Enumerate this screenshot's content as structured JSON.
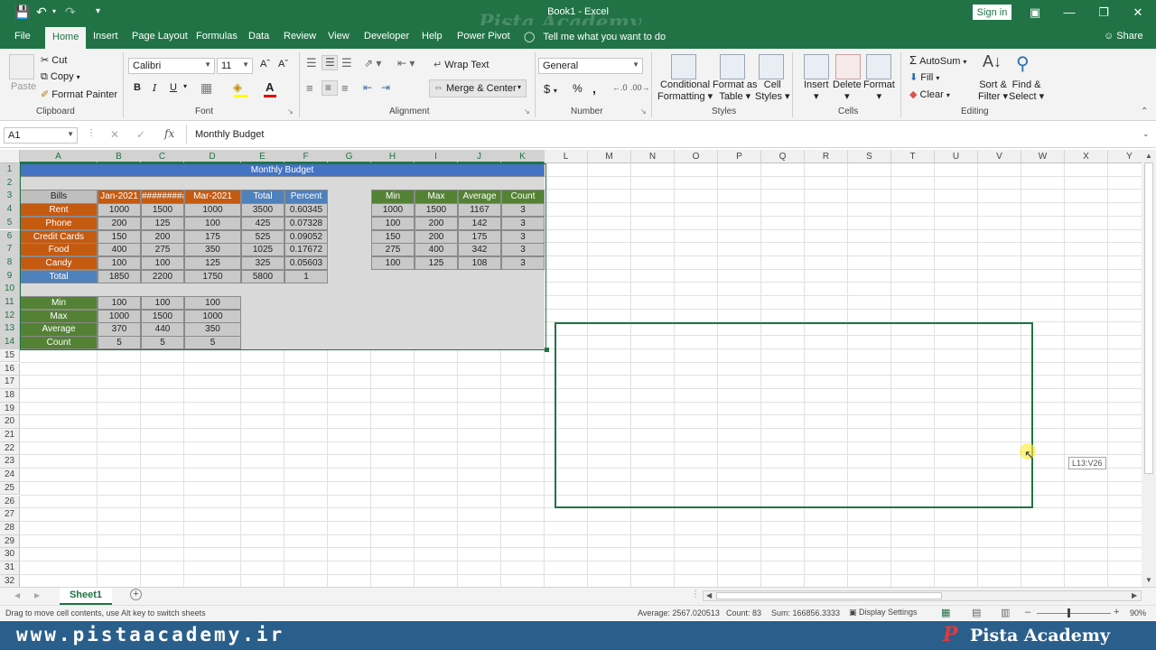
{
  "window": {
    "title": "Book1  -  Excel",
    "watermark": "Pista Academy",
    "signin": "Sign in"
  },
  "tabs": [
    "File",
    "Home",
    "Insert",
    "Page Layout",
    "Formulas",
    "Data",
    "Review",
    "View",
    "Developer",
    "Help",
    "Power Pivot"
  ],
  "tell_me": "Tell me what you want to do",
  "share": "Share",
  "ribbon": {
    "clipboard": {
      "label": "Clipboard",
      "paste": "Paste",
      "cut": "Cut",
      "copy": "Copy",
      "format_painter": "Format Painter"
    },
    "font": {
      "label": "Font",
      "family": "Calibri",
      "size": "11",
      "bold": "B",
      "italic": "I",
      "underline": "U"
    },
    "alignment": {
      "label": "Alignment",
      "wrap": "Wrap Text",
      "merge": "Merge & Center"
    },
    "number": {
      "label": "Number",
      "format": "General",
      "currency": "$",
      "percent": "%",
      "comma": ","
    },
    "styles": {
      "label": "Styles",
      "conditional": "Conditional",
      "conditional2": "Formatting",
      "format_as": "Format as",
      "format_as2": "Table",
      "cell": "Cell",
      "cell2": "Styles"
    },
    "cells": {
      "label": "Cells",
      "insert": "Insert",
      "delete": "Delete",
      "format": "Format"
    },
    "editing": {
      "label": "Editing",
      "autosum": "AutoSum",
      "fill": "Fill",
      "clear": "Clear",
      "sort": "Sort &",
      "sort2": "Filter",
      "find": "Find &",
      "find2": "Select"
    }
  },
  "formula_bar": {
    "name_box": "A1",
    "content": "Monthly Budget"
  },
  "columns": [
    "A",
    "B",
    "C",
    "D",
    "E",
    "F",
    "G",
    "H",
    "I",
    "J",
    "K",
    "L",
    "M",
    "N",
    "O",
    "P",
    "Q",
    "R",
    "S",
    "T",
    "U",
    "V",
    "W",
    "X",
    "Y"
  ],
  "rows": [
    "1",
    "2",
    "3",
    "4",
    "5",
    "6",
    "7",
    "8",
    "9",
    "10",
    "11",
    "12",
    "13",
    "14",
    "15",
    "16",
    "17",
    "18",
    "19",
    "20",
    "21",
    "22",
    "23",
    "24",
    "25",
    "26",
    "27",
    "28",
    "29",
    "30",
    "31",
    "32"
  ],
  "sheet": {
    "title": "Monthly Budget",
    "headers": [
      "Bills",
      "Jan-2021",
      "#########",
      "Mar-2021",
      "Total",
      "Percent"
    ],
    "bills": [
      {
        "name": "Rent",
        "jan": "1000",
        "feb": "1500",
        "mar": "1000",
        "total": "3500",
        "pct": "0.60345"
      },
      {
        "name": "Phone",
        "jan": "200",
        "feb": "125",
        "mar": "100",
        "total": "425",
        "pct": "0.07328"
      },
      {
        "name": "Credit Cards",
        "jan": "150",
        "feb": "200",
        "mar": "175",
        "total": "525",
        "pct": "0.09052"
      },
      {
        "name": "Food",
        "jan": "400",
        "feb": "275",
        "mar": "350",
        "total": "1025",
        "pct": "0.17672"
      },
      {
        "name": "Candy",
        "jan": "100",
        "feb": "100",
        "mar": "125",
        "total": "325",
        "pct": "0.05603"
      }
    ],
    "total_row": {
      "name": "Total",
      "jan": "1850",
      "feb": "2200",
      "mar": "1750",
      "total": "5800",
      "pct": "1"
    },
    "stat_headers": [
      "Min",
      "Max",
      "Average",
      "Count"
    ],
    "row_stats": [
      [
        "1000",
        "1500",
        "1167",
        "3"
      ],
      [
        "100",
        "200",
        "142",
        "3"
      ],
      [
        "150",
        "200",
        "175",
        "3"
      ],
      [
        "275",
        "400",
        "342",
        "3"
      ],
      [
        "100",
        "125",
        "108",
        "3"
      ]
    ],
    "col_stats": [
      {
        "name": "Min",
        "jan": "100",
        "feb": "100",
        "mar": "100"
      },
      {
        "name": "Max",
        "jan": "1000",
        "feb": "1500",
        "mar": "1000"
      },
      {
        "name": "Average",
        "jan": "370",
        "feb": "440",
        "mar": "350"
      },
      {
        "name": "Count",
        "jan": "5",
        "feb": "5",
        "mar": "5"
      }
    ]
  },
  "drag_tooltip": "L13:V26",
  "sheet_tab": "Sheet1",
  "status": {
    "message": "Drag to move cell contents, use Alt key to switch sheets",
    "average": "Average: 2567.020513",
    "count": "Count: 83",
    "sum": "Sum: 166856.3333",
    "display": "Display Settings",
    "zoom": "90%"
  },
  "brand": {
    "site": "www.pistaacademy.ir",
    "name": "Pista Academy"
  },
  "colors": {
    "excel_green": "#217346",
    "blue": "#4472c4",
    "orange": "#c55a11",
    "green": "#548235",
    "steel": "#4f81bd",
    "gray": "#bfbfbf"
  }
}
